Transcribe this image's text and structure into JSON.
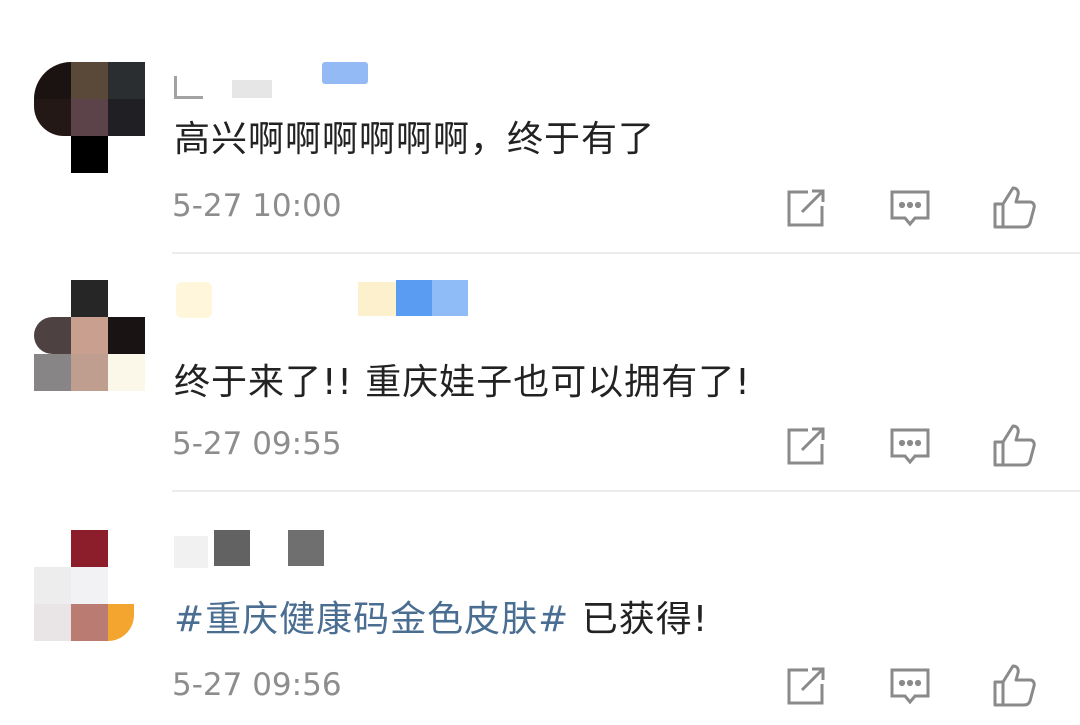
{
  "comments": [
    {
      "text": "高兴啊啊啊啊啊啊，终于有了",
      "time": "5-27 10:00",
      "avatar_colors": [
        "#1b1212",
        "#5a4838",
        "#2a2e31",
        "#231816",
        "#5b4349",
        "#1f1f24",
        "#ffffff",
        "#000000",
        "#ffffff"
      ]
    },
    {
      "text": "终于来了!! 重庆娃子也可以拥有了!",
      "time": "5-27 09:55",
      "avatar_colors": [
        "#ffffff",
        "#262626",
        "#ffffff",
        "#4d4241",
        "#c9a090",
        "#1a1313",
        "#878585",
        "#c09e8f",
        "#fbf8e9"
      ]
    },
    {
      "hashtag": "#重庆健康码金色皮肤#",
      "text": " 已获得!",
      "time": "5-27 09:56",
      "avatar_colors": [
        "#ffffff",
        "#8c1e2c",
        "#ffffff",
        "#ededed",
        "#f2f2f4",
        "#ffffff",
        "#e9e4e6",
        "#ba7b72",
        "#f3a52f"
      ]
    }
  ],
  "icons": {
    "share": "share-icon",
    "reply": "comment-icon",
    "like": "thumbs-up-icon"
  },
  "colors": {
    "text": "#222222",
    "time": "#8d8d8d",
    "hashtag": "#4a6d92",
    "icon": "#8a8a8a"
  }
}
